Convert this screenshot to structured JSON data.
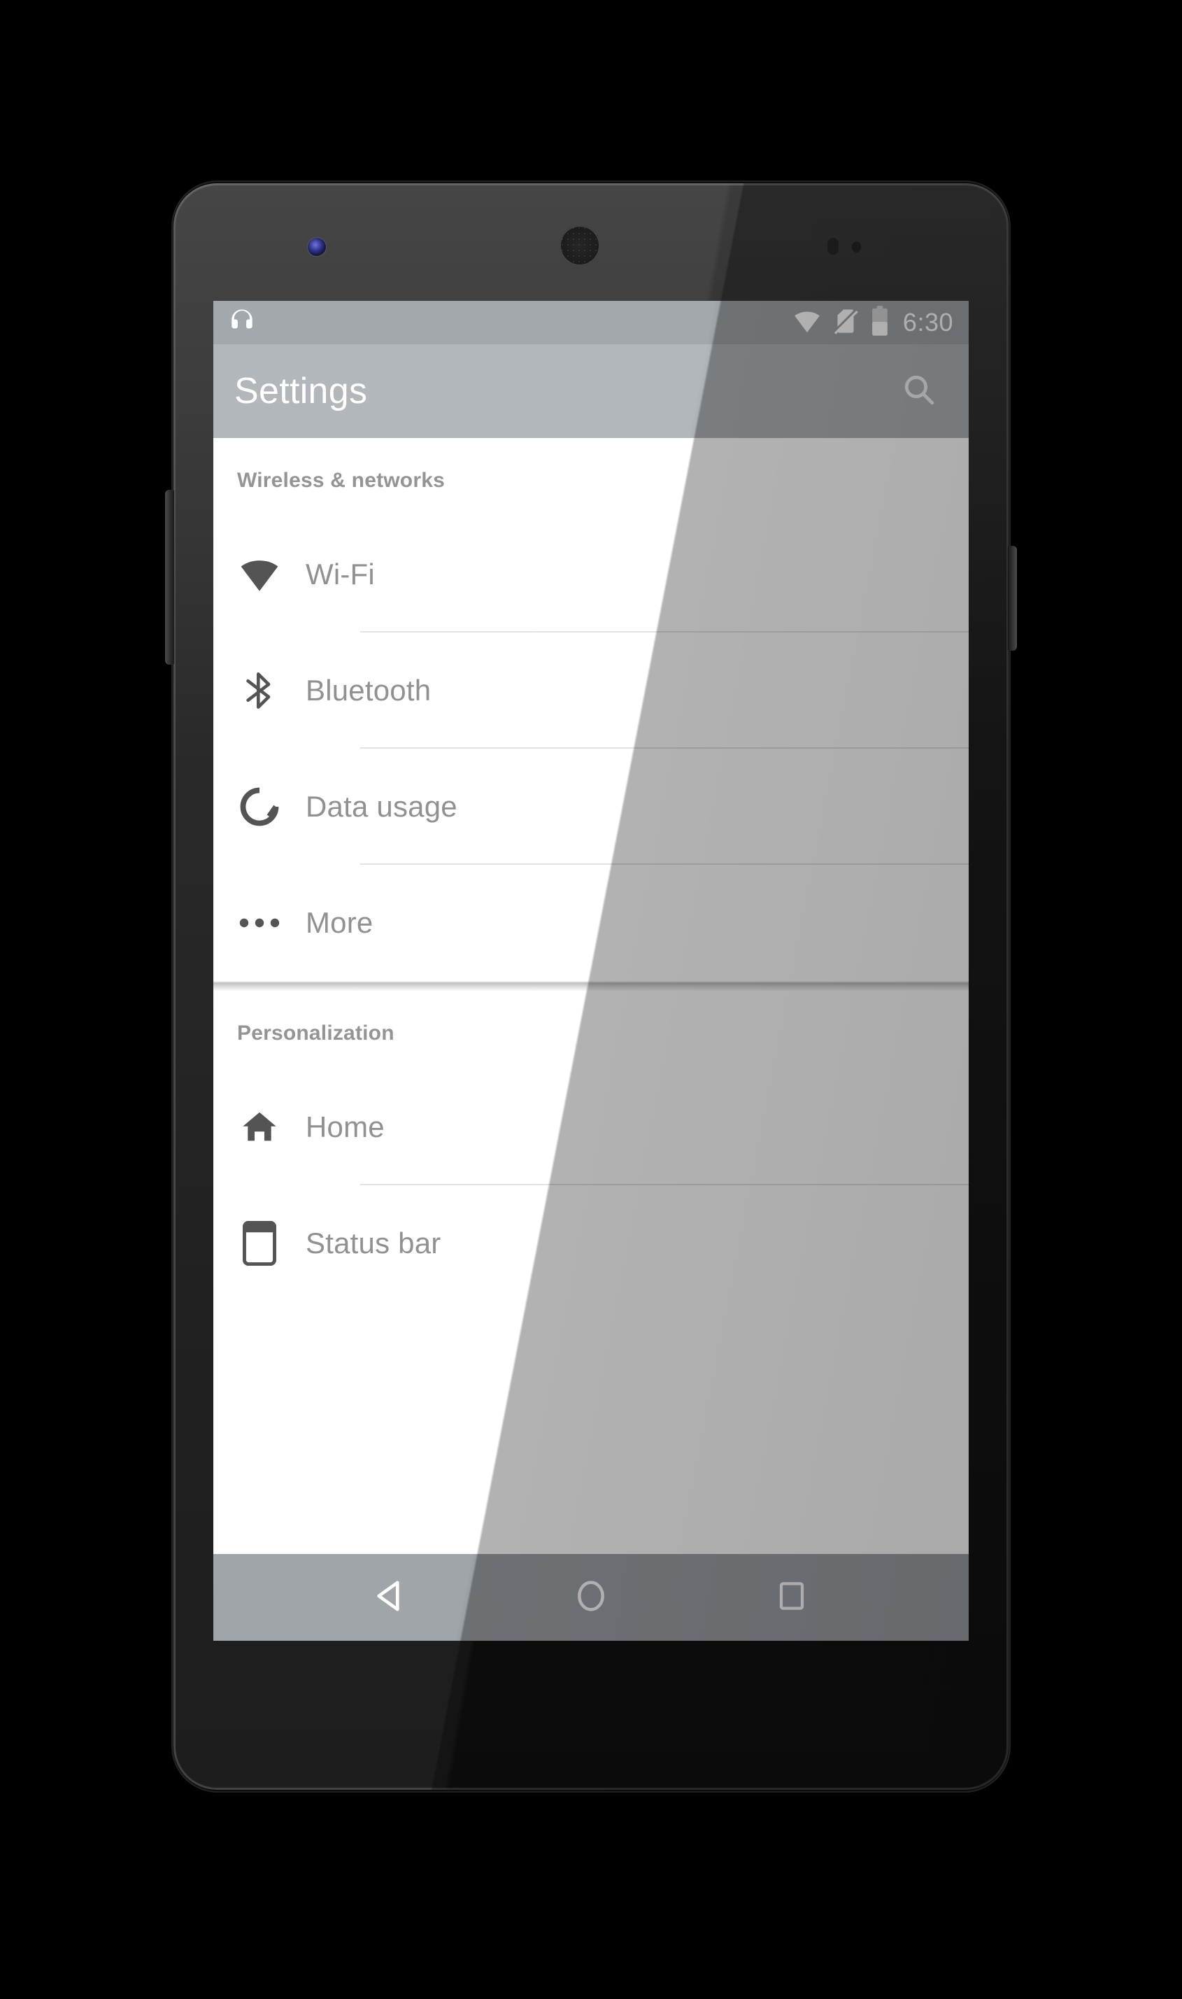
{
  "device": {
    "name": "android-phone",
    "hardware": {
      "front_camera": "front-camera",
      "earpiece": "earpiece-speaker",
      "proximity_sensor": "proximity-sensor",
      "light_sensor": "light-sensor",
      "volume_rocker": "volume-rocker",
      "power_button": "power-button"
    }
  },
  "colors": {
    "status_bar": "#9ea3a7",
    "toolbar": "#aeb3b7",
    "nav_bar": "#9ba0a5",
    "content_bg": "#ffffff",
    "section_header_text": "#8e8e8e",
    "row_label_text": "#8b8b8b",
    "row_icon": "#4a4a4a",
    "divider": "#e3e3e3",
    "phone_body": "#1d1d1d"
  },
  "status_bar": {
    "left_icons": [
      {
        "name": "headphones-icon",
        "label": "Headphones connected"
      }
    ],
    "right_icons": [
      {
        "name": "wifi-icon",
        "label": "Wi-Fi full signal"
      },
      {
        "name": "no-sim-icon",
        "label": "No SIM card"
      },
      {
        "name": "battery-icon",
        "label": "Battery",
        "level_percent": 50
      }
    ],
    "clock": "6:30"
  },
  "toolbar": {
    "title": "Settings",
    "search": {
      "name": "search-icon",
      "label": "Search"
    }
  },
  "sections": [
    {
      "header": "Wireless & networks",
      "items": [
        {
          "label": "Wi-Fi",
          "icon": "wifi-icon"
        },
        {
          "label": "Bluetooth",
          "icon": "bluetooth-icon"
        },
        {
          "label": "Data usage",
          "icon": "data-usage-icon"
        },
        {
          "label": "More",
          "icon": "more-horizontal-icon"
        }
      ]
    },
    {
      "header": "Personalization",
      "items": [
        {
          "label": "Home",
          "icon": "home-icon"
        },
        {
          "label": "Status bar",
          "icon": "status-bar-icon"
        }
      ]
    }
  ],
  "nav_bar": {
    "buttons": [
      {
        "name": "back-button",
        "icon": "back-triangle-icon",
        "label": "Back"
      },
      {
        "name": "home-button",
        "icon": "home-circle-icon",
        "label": "Home"
      },
      {
        "name": "recents-button",
        "icon": "recents-square-icon",
        "label": "Recent apps"
      }
    ]
  }
}
